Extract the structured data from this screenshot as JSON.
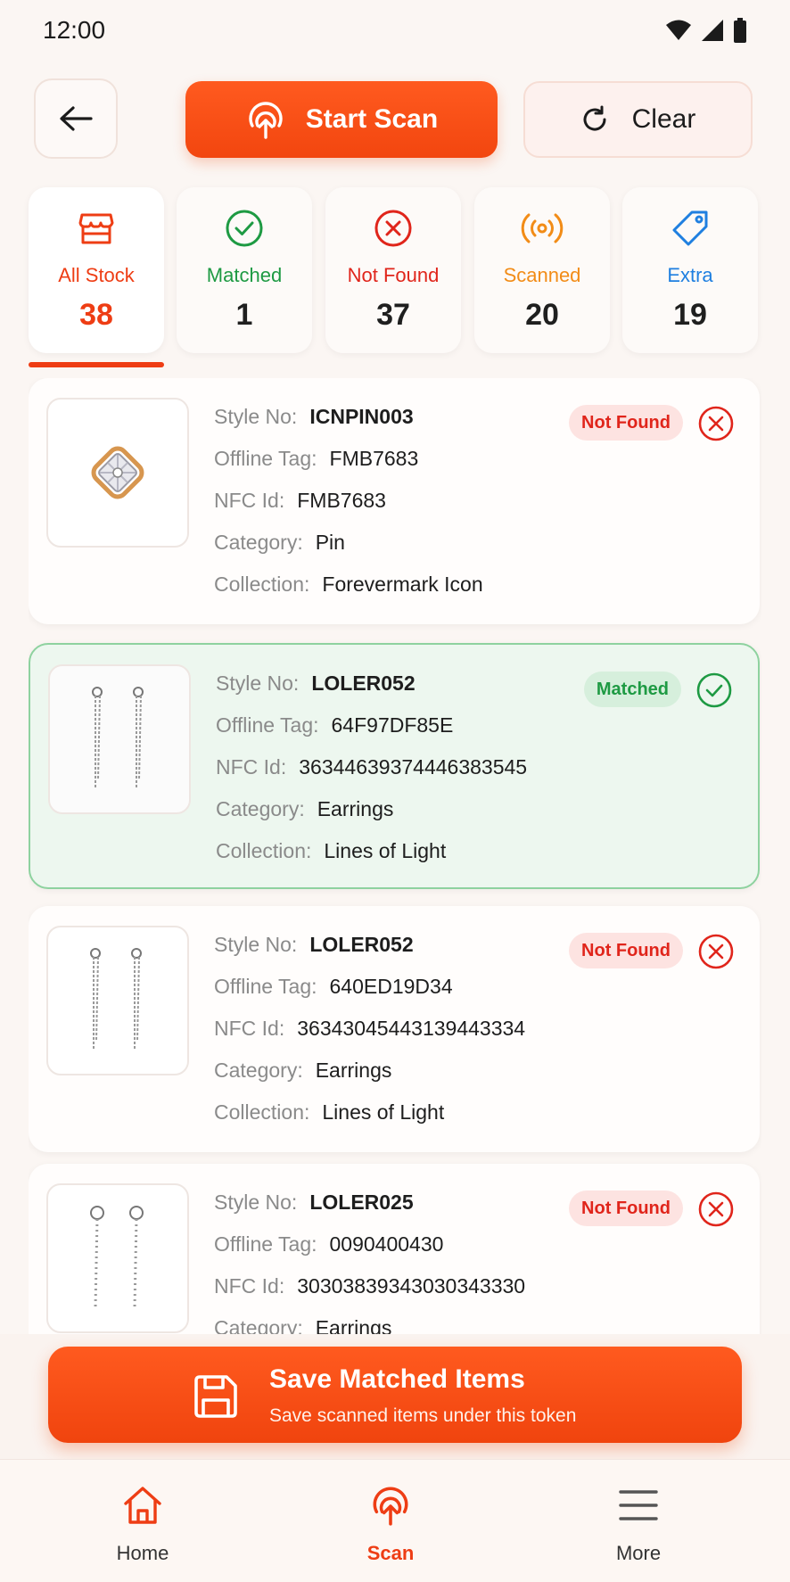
{
  "status_bar": {
    "time": "12:00"
  },
  "top_actions": {
    "start_scan_label": "Start Scan",
    "clear_label": "Clear"
  },
  "stats": [
    {
      "label": "All Stock",
      "value": "38",
      "color": "#ee3d14",
      "icon": "store-icon"
    },
    {
      "label": "Matched",
      "value": "1",
      "color": "#1e9a43",
      "icon": "check-circle-icon"
    },
    {
      "label": "Not Found",
      "value": "37",
      "color": "#e0251b",
      "icon": "x-circle-icon"
    },
    {
      "label": "Scanned",
      "value": "20",
      "color": "#f28c17",
      "icon": "radar-icon"
    },
    {
      "label": "Extra",
      "value": "19",
      "color": "#1f7fe0",
      "icon": "tag-icon"
    }
  ],
  "field_labels": {
    "style_no": "Style No:",
    "offline_tag": "Offline Tag:",
    "nfc_id": "NFC Id:",
    "category": "Category:",
    "collection": "Collection:"
  },
  "items": [
    {
      "style_no": "ICNPIN003",
      "offline_tag": "FMB7683",
      "nfc_id": "FMB7683",
      "category": "Pin",
      "collection": "Forevermark Icon",
      "status": "Not Found"
    },
    {
      "style_no": "LOLER052",
      "offline_tag": "64F97DF85E",
      "nfc_id": "36344639374446383545",
      "category": "Earrings",
      "collection": "Lines of Light",
      "status": "Matched"
    },
    {
      "style_no": "LOLER052",
      "offline_tag": "640ED19D34",
      "nfc_id": "36343045443139443334",
      "category": "Earrings",
      "collection": "Lines of Light",
      "status": "Not Found"
    },
    {
      "style_no": "LOLER025",
      "offline_tag": "0090400430",
      "nfc_id": "30303839343030343330",
      "category": "Earrings",
      "collection": "",
      "status": "Not Found"
    }
  ],
  "save": {
    "title": "Save Matched Items",
    "subtitle": "Save scanned items under this token"
  },
  "bottom_nav": [
    {
      "label": "Home",
      "icon": "home-icon"
    },
    {
      "label": "Scan",
      "icon": "scan-icon"
    },
    {
      "label": "More",
      "icon": "menu-icon"
    }
  ],
  "colors": {
    "accent": "#ee3d14",
    "matched": "#1e9a43",
    "not_found": "#e0251b"
  }
}
